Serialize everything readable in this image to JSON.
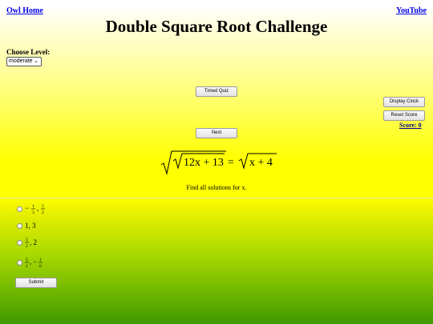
{
  "nav": {
    "home_label": "Owl Home",
    "youtube_label": "YouTube"
  },
  "header": {
    "title": "Double Square Root Challenge"
  },
  "level": {
    "label": "Choose Level:",
    "selected": "moderate"
  },
  "buttons": {
    "timed_quiz": "Timed Quiz",
    "display_clock": "Display Clock",
    "reset_score": "Reset Score",
    "next": "Next",
    "submit": "Submit"
  },
  "score": {
    "label": "Score: 0"
  },
  "problem": {
    "equation_parts": [
      "12x + 13",
      "=",
      "x + 4"
    ],
    "instruction": "Find all solutions for x."
  },
  "options": [
    [
      "−",
      "1",
      "3",
      ",",
      "5",
      "2"
    ],
    [
      "1, 3"
    ],
    [
      "5",
      "2",
      ", 2"
    ],
    [
      "5",
      "2",
      ",",
      "−",
      "1",
      "6"
    ]
  ]
}
